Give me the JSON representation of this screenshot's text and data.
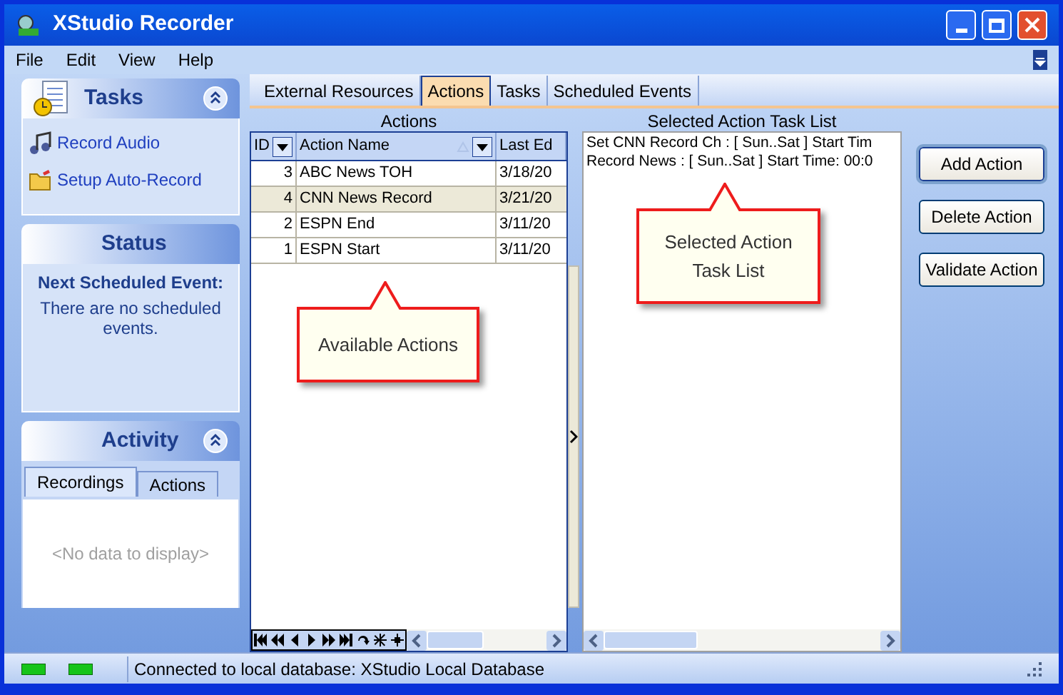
{
  "window": {
    "title": "XStudio Recorder"
  },
  "menu": [
    "File",
    "Edit",
    "View",
    "Help"
  ],
  "sidebar": {
    "tasks": {
      "title": "Tasks",
      "items": [
        {
          "label": "Record Audio",
          "kind": "music"
        },
        {
          "label": "Setup Auto-Record",
          "kind": "folder"
        }
      ]
    },
    "status": {
      "title": "Status",
      "heading": "Next Scheduled Event:",
      "message": "There are no scheduled events."
    },
    "activity": {
      "title": "Activity",
      "tabs": [
        {
          "label": "Recordings",
          "selected": true
        },
        {
          "label": "Actions",
          "selected": false
        }
      ],
      "empty": "<No data to display>"
    }
  },
  "tabs": [
    {
      "label": "External Resources",
      "selected": false
    },
    {
      "label": "Actions",
      "selected": true
    },
    {
      "label": "Tasks",
      "selected": false
    },
    {
      "label": "Scheduled Events",
      "selected": false
    }
  ],
  "actions": {
    "caption": "Actions",
    "columns": [
      "ID",
      "Action Name",
      "Last Ed"
    ],
    "rows": [
      {
        "id": "3",
        "name": "ABC News TOH",
        "last_edited": "3/18/20",
        "selected": false
      },
      {
        "id": "4",
        "name": "CNN News Record",
        "last_edited": "3/21/20",
        "selected": true
      },
      {
        "id": "2",
        "name": "ESPN End",
        "last_edited": "3/11/20",
        "selected": false
      },
      {
        "id": "1",
        "name": "ESPN Start",
        "last_edited": "3/11/20",
        "selected": false
      }
    ]
  },
  "task_list": {
    "caption": "Selected Action Task List",
    "lines": [
      "Set CNN Record Ch : [ Sun..Sat ] Start Tim",
      "Record News : [ Sun..Sat ] Start Time: 00:0"
    ]
  },
  "buttons": [
    {
      "label": "Add Action",
      "focused": true
    },
    {
      "label": "Delete Action",
      "focused": false
    },
    {
      "label": "Validate Action",
      "focused": false
    }
  ],
  "callouts": [
    "Available Actions",
    "Selected Action Task List"
  ],
  "status_bar": {
    "message": "Connected to local database: XStudio Local Database"
  }
}
